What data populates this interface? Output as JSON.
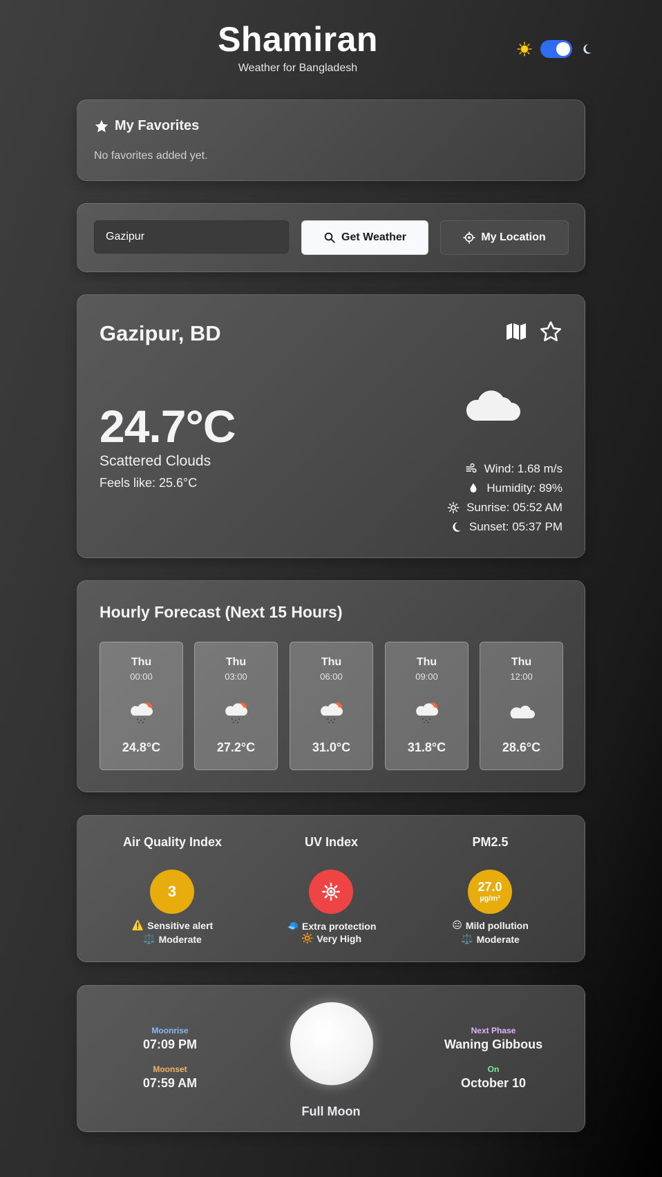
{
  "header": {
    "title": "Shamiran",
    "subtitle": "Weather for Bangladesh",
    "theme_toggle_on": true
  },
  "favorites": {
    "title": "My Favorites",
    "empty_text": "No favorites added yet."
  },
  "search": {
    "value": "Gazipur",
    "get_weather_label": "Get Weather",
    "my_location_label": "My Location"
  },
  "current": {
    "city": "Gazipur, BD",
    "temperature": "24.7°C",
    "description": "Scattered Clouds",
    "feels_like": "Feels like: 25.6°C",
    "wind": "Wind: 1.68 m/s",
    "humidity": "Humidity: 89%",
    "sunrise": "Sunrise: 05:52 AM",
    "sunset": "Sunset: 05:37 PM",
    "icon": "cloud-icon"
  },
  "hourly": {
    "title": "Hourly Forecast (Next 15 Hours)",
    "items": [
      {
        "day": "Thu",
        "time": "00:00",
        "temp": "24.8°C",
        "icon": "rain-sun-cloud-icon"
      },
      {
        "day": "Thu",
        "time": "03:00",
        "temp": "27.2°C",
        "icon": "rain-sun-cloud-icon"
      },
      {
        "day": "Thu",
        "time": "06:00",
        "temp": "31.0°C",
        "icon": "rain-sun-cloud-icon"
      },
      {
        "day": "Thu",
        "time": "09:00",
        "temp": "31.8°C",
        "icon": "rain-sun-cloud-icon"
      },
      {
        "day": "Thu",
        "time": "12:00",
        "temp": "28.6°C",
        "icon": "cloud-icon"
      }
    ]
  },
  "indices": {
    "aqi": {
      "title": "Air Quality Index",
      "value": "3",
      "color": "#e8ad0c",
      "line1": "Sensitive alert",
      "line2": "Moderate"
    },
    "uv": {
      "title": "UV Index",
      "color": "#ee4444",
      "line1": "Extra protection",
      "line2": "Very High"
    },
    "pm25": {
      "title": "PM2.5",
      "value": "27.0",
      "unit": "µg/m³",
      "color": "#e8ad0c",
      "line1": "Mild pollution",
      "line2": "Moderate"
    }
  },
  "moon": {
    "moonrise_label": "Moonrise",
    "moonrise": "07:09 PM",
    "moonset_label": "Moonset",
    "moonset": "07:59 AM",
    "phase": "Full Moon",
    "next_phase_label": "Next Phase",
    "next_phase": "Waning Gibbous",
    "on_label": "On",
    "on_date": "October 10"
  }
}
